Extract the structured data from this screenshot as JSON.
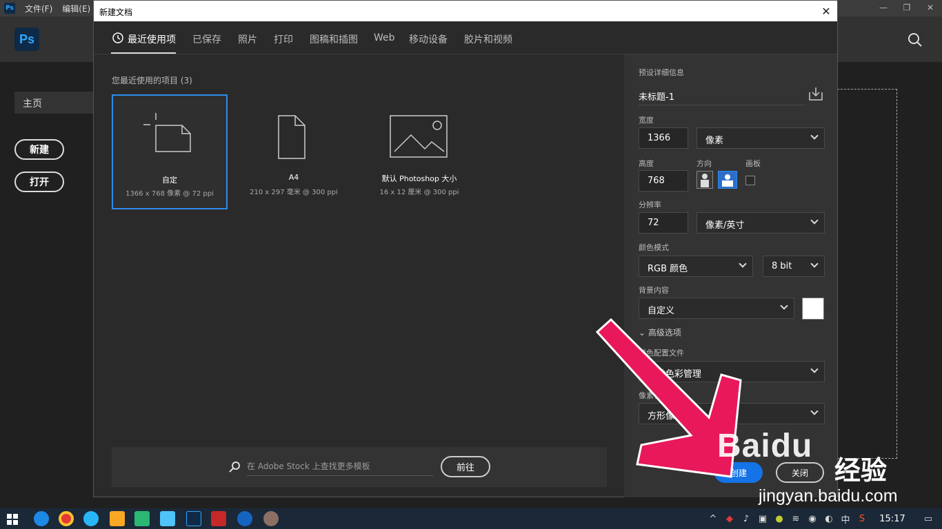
{
  "menubar": {
    "app_icon": "Ps",
    "menus": [
      "文件(F)",
      "编辑(E)"
    ]
  },
  "home": {
    "logo": "Ps",
    "tab": "主页",
    "new_btn": "新建",
    "open_btn": "打开"
  },
  "dialog": {
    "title": "新建文档",
    "tabs": [
      "最近使用项",
      "已保存",
      "照片",
      "打印",
      "图稿和插图",
      "Web",
      "移动设备",
      "胶片和视频"
    ],
    "recent_title": "您最近使用的项目 (3)",
    "cards": [
      {
        "name": "自定",
        "sub": "1366 x 768 像素 @ 72 ppi"
      },
      {
        "name": "A4",
        "sub": "210 x 297 毫米 @ 300 ppi"
      },
      {
        "name": "默认 Photoshop 大小",
        "sub": "16 x 12 厘米 @ 300 ppi"
      }
    ],
    "stock_placeholder": "在 Adobe Stock 上查找更多模板",
    "stock_go": "前往"
  },
  "details": {
    "header": "预设详细信息",
    "doc_name": "未标题-1",
    "width_label": "宽度",
    "width_value": "1366",
    "width_unit": "像素",
    "height_label": "高度",
    "height_value": "768",
    "orientation_label": "方向",
    "artboard_label": "画板",
    "resolution_label": "分辨率",
    "resolution_value": "72",
    "resolution_unit": "像素/英寸",
    "color_mode_label": "颜色模式",
    "color_mode": "RGB 颜色",
    "bit_depth": "8 bit",
    "bg_label": "背景内容",
    "bg_value": "自定义",
    "advanced": "高级选项",
    "profile_label": "颜色配置文件",
    "profile_value": "不做色彩管理",
    "pixel_aspect_label": "像素长宽比",
    "pixel_aspect_value": "方形像素",
    "create_btn": "创建",
    "close_btn": "关闭"
  },
  "watermark": {
    "logo": "Baidu",
    "text": "经验",
    "url": "jingyan.baidu.com"
  },
  "taskbar": {
    "ime": "中",
    "time": "15:17"
  },
  "colors": {
    "accent": "#1473e6",
    "arrow": "#e8185a",
    "selection": "#2d8ceb"
  }
}
